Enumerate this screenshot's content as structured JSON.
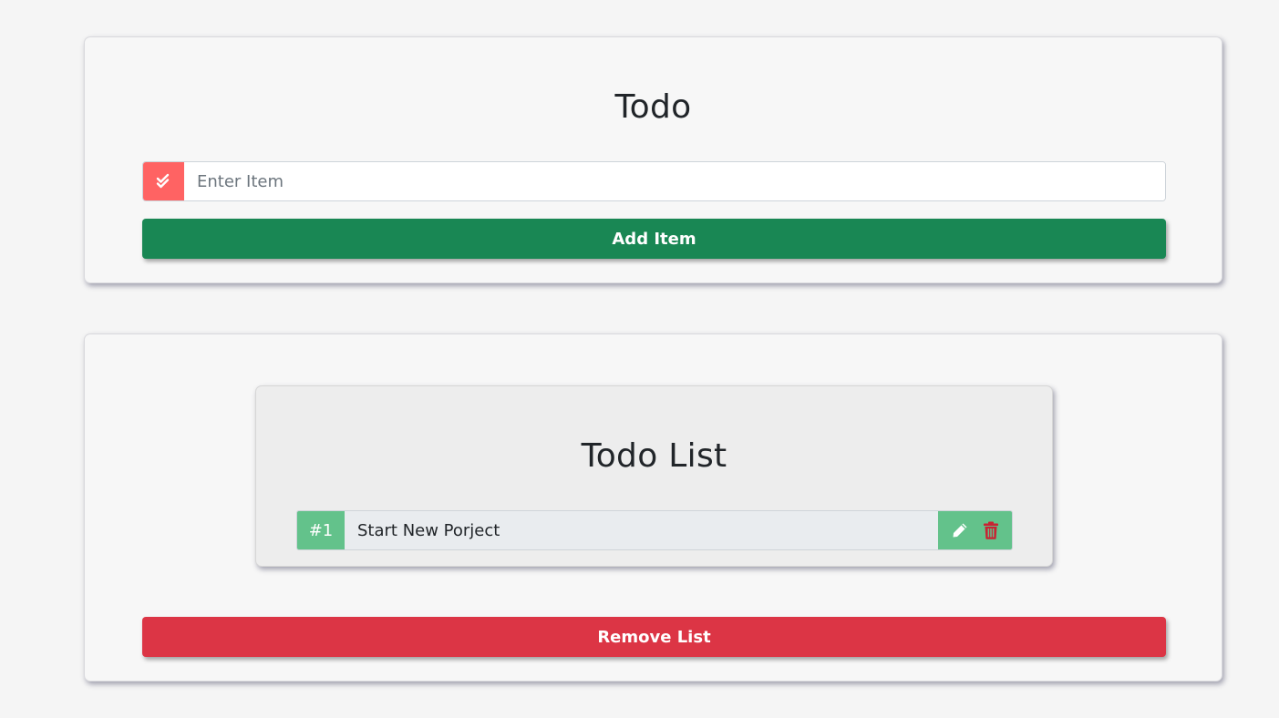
{
  "add_card": {
    "title": "Todo",
    "input_placeholder": "Enter Item",
    "input_value": "",
    "add_button_label": "Add Item"
  },
  "list_card": {
    "title": "Todo List",
    "items": [
      {
        "number": "#1",
        "text": "Start New Porject"
      }
    ],
    "remove_button_label": "Remove List"
  },
  "colors": {
    "check_addon": "#ff6363",
    "add_button": "#198754",
    "remove_button": "#dc3545",
    "item_accent": "#63c28b",
    "delete_icon": "#c82333"
  },
  "icons": {
    "input_addon": "double-check-icon",
    "edit": "pencil-icon",
    "delete": "trash-icon"
  }
}
